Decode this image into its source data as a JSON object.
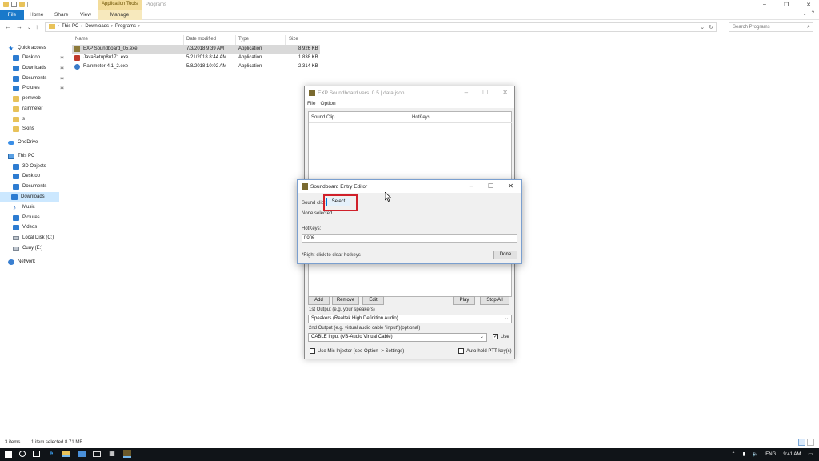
{
  "explorer": {
    "context_tab": "Application Tools",
    "context_name": "Programs",
    "ribbon_tabs": {
      "file": "File",
      "home": "Home",
      "share": "Share",
      "view": "View",
      "manage": "Manage"
    },
    "breadcrumb": [
      "This PC",
      "Downloads",
      "Programs"
    ],
    "search_placeholder": "Search Programs",
    "nav": {
      "quick_access": "Quick access",
      "desktop": "Desktop",
      "downloads": "Downloads",
      "documents": "Documents",
      "pictures": "Pictures",
      "pemweb": "pemweb",
      "rainmeter": "rainmeter",
      "s": "s",
      "skins": "Skins",
      "onedrive": "OneDrive",
      "this_pc": "This PC",
      "objects3d": "3D Objects",
      "desktop2": "Desktop",
      "documents2": "Documents",
      "downloads2": "Downloads",
      "music": "Music",
      "pictures2": "Pictures",
      "videos": "Videos",
      "local_disk": "Local Disk (C:)",
      "cuuy": "Cuuy (E:)",
      "network": "Network"
    },
    "columns": {
      "name": "Name",
      "date": "Date modified",
      "type": "Type",
      "size": "Size"
    },
    "files": [
      {
        "name": "EXP Soundboard_05.exe",
        "date": "7/3/2018 9:39 AM",
        "type": "Application",
        "size": "8,926 KB"
      },
      {
        "name": "JavaSetup8u171.exe",
        "date": "5/21/2018 8:44 AM",
        "type": "Application",
        "size": "1,838 KB"
      },
      {
        "name": "Rainmeter-4.1_2.exe",
        "date": "5/8/2018 10:02 AM",
        "type": "Application",
        "size": "2,314 KB"
      }
    ],
    "status": {
      "items": "3 items",
      "selected": "1 item selected  8.71 MB"
    }
  },
  "soundboard": {
    "title": "EXP Soundboard vers. 0.5 | data.json",
    "menu": {
      "file": "File",
      "option": "Option"
    },
    "col_clip": "Sound Clip",
    "col_hotkeys": "HotKeys",
    "buttons": {
      "add": "Add",
      "remove": "Remove",
      "edit": "Edit",
      "play": "Play",
      "stop_all": "Stop All"
    },
    "output1_label": "1st Output (e.g. your speakers)",
    "output1_value": "Speakers (Realtek High Definition Audio)",
    "output2_label": "2nd Output (e.g. virtual audio cable \"input\")(optional)",
    "output2_value": "CABLE Input (VB-Audio Virtual Cable)",
    "use_label": "Use",
    "mic_injector": "Use Mic Injector (see Option -> Settings)",
    "auto_hold": "Auto-hold PTT key(s)"
  },
  "editor": {
    "title": "Soundboard Entry Editor",
    "sound_clip_label": "Sound clip:",
    "select_button": "Select",
    "none_selected": "None selected",
    "hotkeys_label": "HotKeys:",
    "hotkeys_value": "none",
    "hint": "*Right-click to clear hotkeys",
    "done_button": "Done"
  },
  "tray": {
    "lang": "ENG",
    "time": "9:41 AM"
  }
}
